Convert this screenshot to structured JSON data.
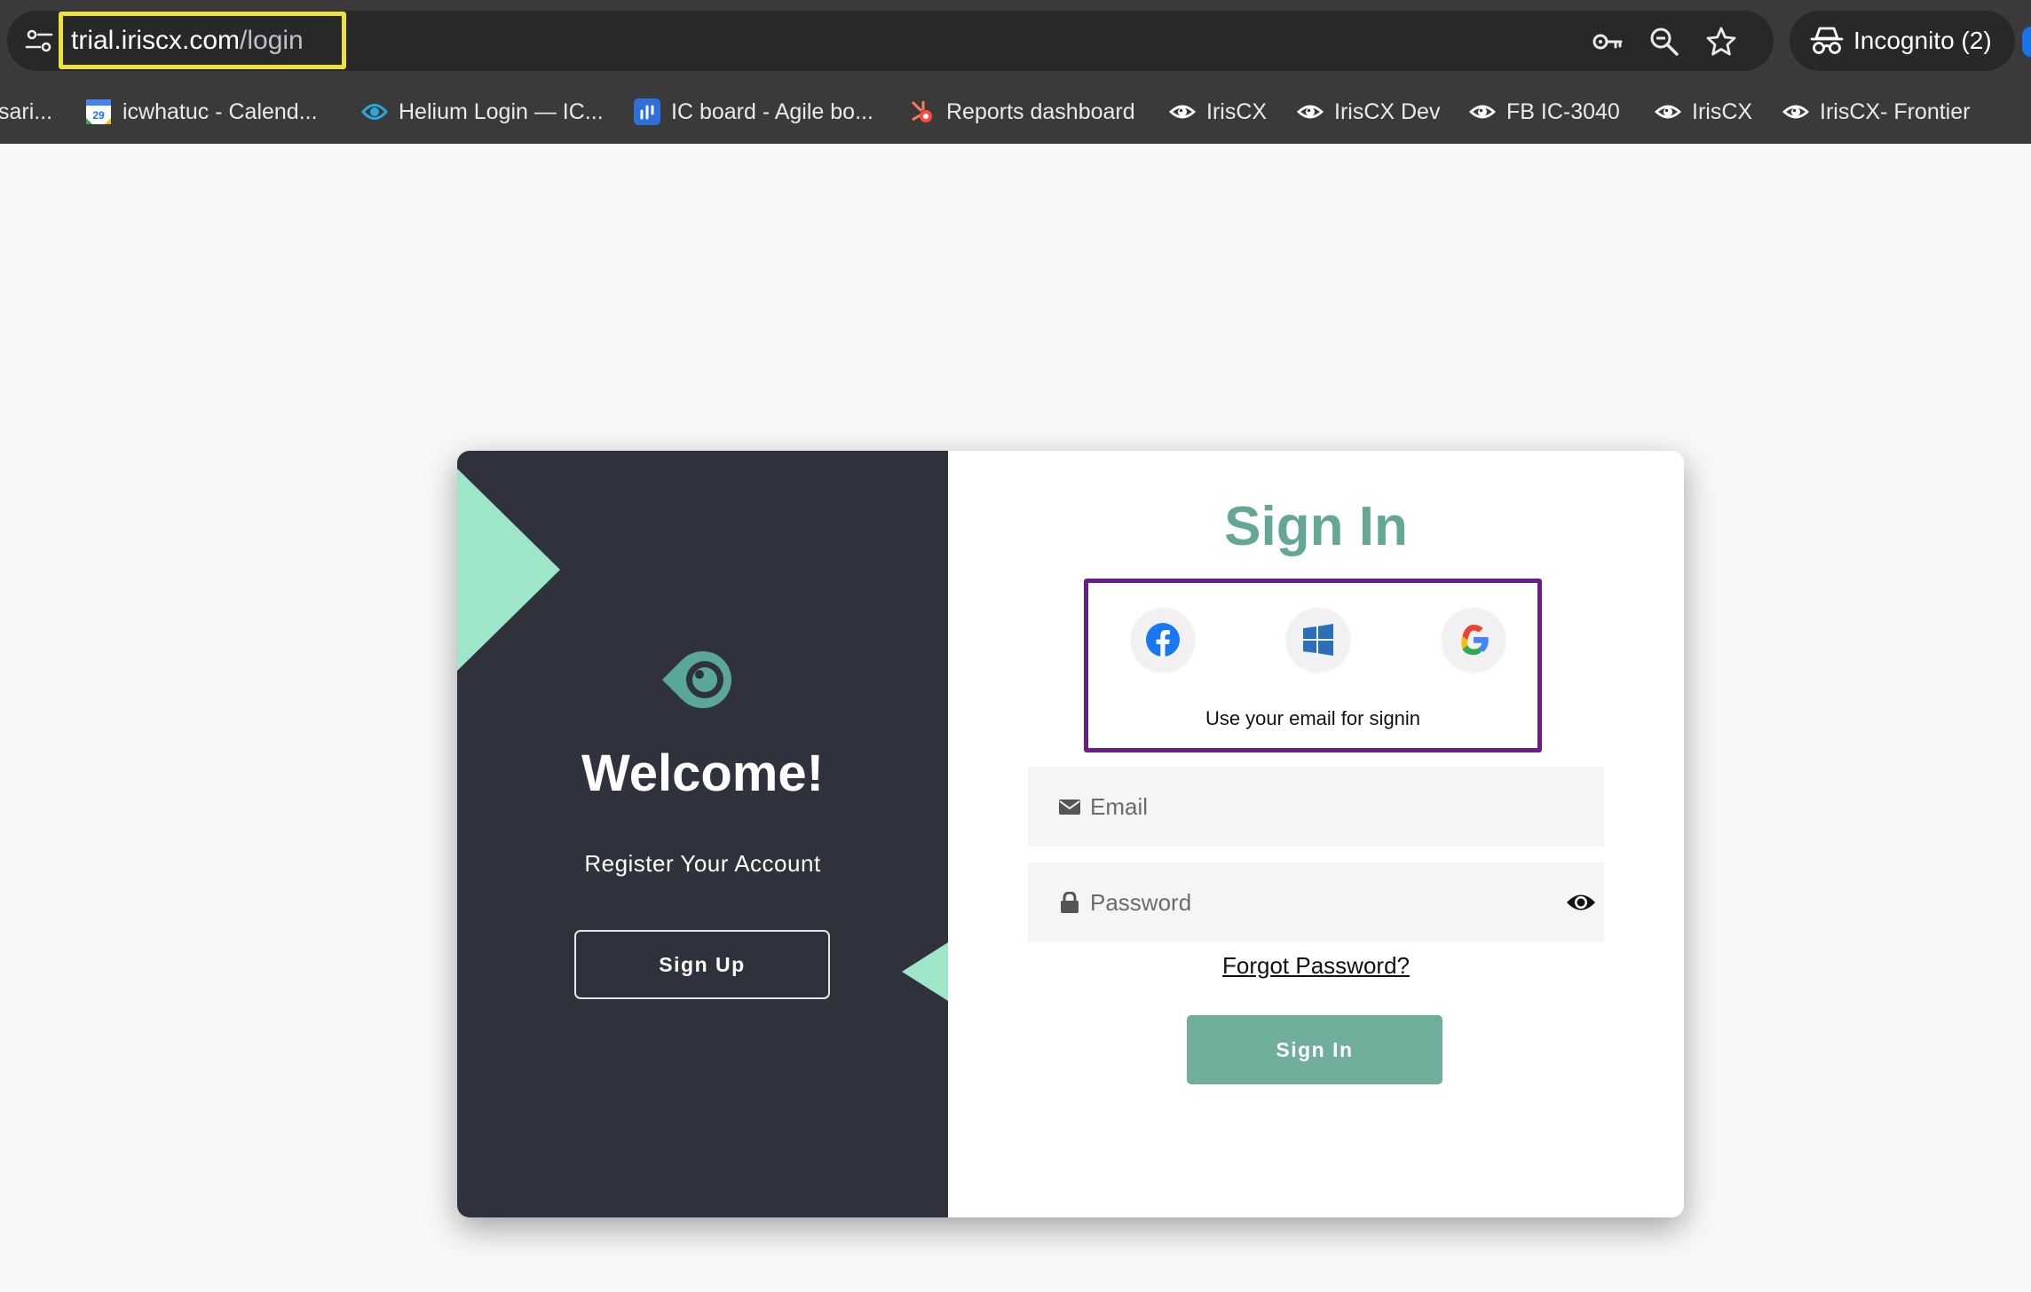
{
  "browser": {
    "url_host": "trial.iriscx.com",
    "url_path": "/login",
    "incognito_label": "Incognito (2)",
    "toolbar_icons": [
      "key-icon",
      "zoom-icon",
      "star-icon"
    ],
    "bookmarks": [
      {
        "label": "sari...",
        "icon": "none"
      },
      {
        "label": "icwhatuc - Calend...",
        "icon": "calendar-icon"
      },
      {
        "label": "Helium Login — IC...",
        "icon": "helium-icon"
      },
      {
        "label": "IC board - Agile bo...",
        "icon": "jira-icon"
      },
      {
        "label": "Reports dashboard",
        "icon": "hubspot-icon"
      },
      {
        "label": "IrisCX",
        "icon": "iris-eye-icon"
      },
      {
        "label": "IrisCX Dev",
        "icon": "iris-eye-icon"
      },
      {
        "label": "FB IC-3040",
        "icon": "iris-eye-icon"
      },
      {
        "label": "IrisCX",
        "icon": "iris-eye-icon"
      },
      {
        "label": "IrisCX- Frontier",
        "icon": "iris-eye-icon"
      }
    ],
    "calendar_day": "29"
  },
  "left_panel": {
    "welcome": "Welcome!",
    "subtitle": "Register Your Account",
    "signup_label": "Sign Up"
  },
  "right_panel": {
    "title": "Sign In",
    "social_providers": [
      "facebook-icon",
      "windows-icon",
      "google-icon"
    ],
    "social_note": "Use your email for signin",
    "email_placeholder": "Email",
    "password_placeholder": "Password",
    "forgot_label": "Forgot Password?",
    "signin_label": "Sign In"
  },
  "colors": {
    "accent_green": "#64a796",
    "button_green": "#6eae9b",
    "triangle_mint": "#9de6c7",
    "dark_panel": "#2f313d",
    "url_highlight": "#ece23a",
    "social_highlight": "#6a1f86"
  }
}
